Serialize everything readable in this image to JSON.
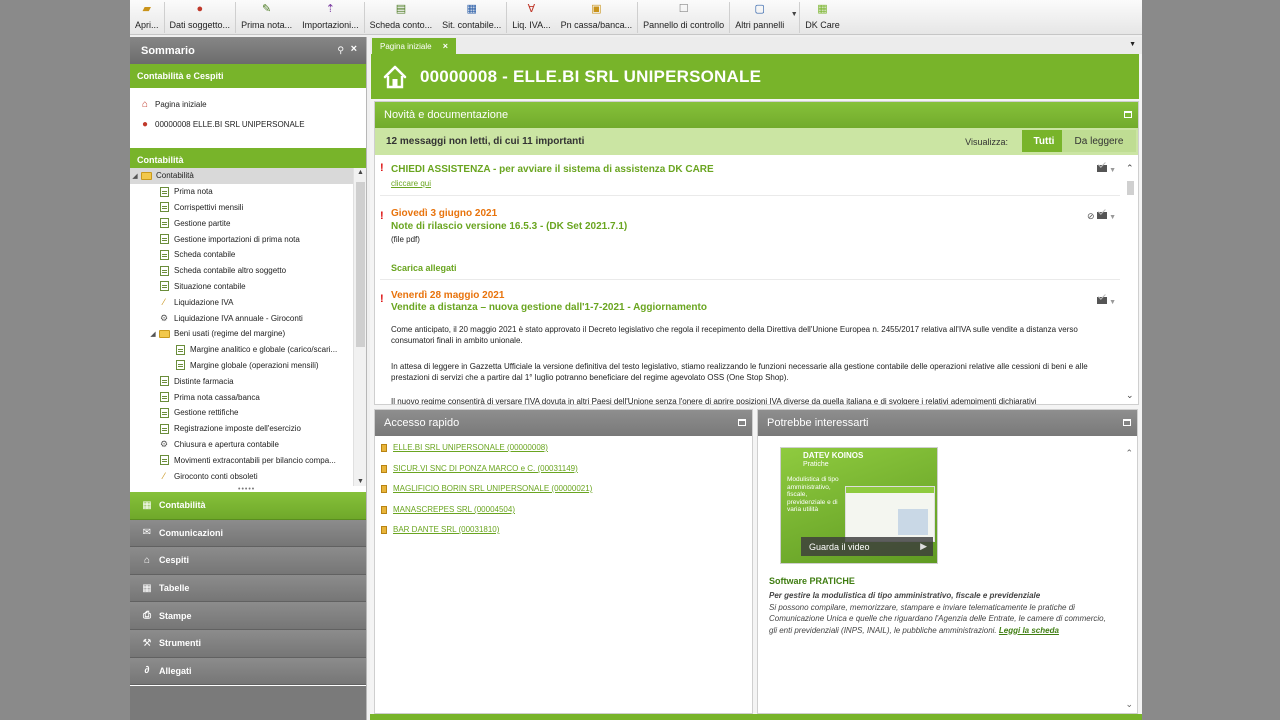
{
  "toolbar": {
    "items": [
      {
        "label": "Apri...",
        "icon": "folder-open-icon"
      },
      {
        "label": "Dati soggetto...",
        "icon": "person-icon"
      },
      {
        "label": "Prima nota...",
        "icon": "journal-icon"
      },
      {
        "label": "Importazioni...",
        "icon": "import-icon"
      },
      {
        "label": "Scheda conto...",
        "icon": "account-sheet-icon"
      },
      {
        "label": "Sit. contabile...",
        "icon": "ledger-icon"
      },
      {
        "label": "Liq. IVA...",
        "icon": "vat-icon"
      },
      {
        "label": "Pn cassa/banca...",
        "icon": "cash-icon"
      },
      {
        "label": "Pannello di controllo",
        "icon": "control-panel-icon"
      },
      {
        "label": "Altri pannelli",
        "icon": "panels-icon"
      },
      {
        "label": "DK Care",
        "icon": "dk-care-icon"
      }
    ]
  },
  "sidebar": {
    "title": "Sommario",
    "section1": "Contabilità e Cespiti",
    "shortcuts": [
      {
        "label": "Pagina iniziale",
        "icon": "home-icon"
      },
      {
        "label": "00000008 ELLE.BI SRL UNIPERSONALE",
        "icon": "person-icon"
      }
    ],
    "section2": "Contabilità",
    "tree": [
      {
        "label": "Contabilità",
        "level": 0,
        "kind": "folder",
        "expanded": true,
        "selected": true
      },
      {
        "label": "Prima nota",
        "level": 1,
        "kind": "doc"
      },
      {
        "label": "Corrispettivi mensili",
        "level": 1,
        "kind": "doc"
      },
      {
        "label": "Gestione partite",
        "level": 1,
        "kind": "doc"
      },
      {
        "label": "Gestione importazioni di prima nota",
        "level": 1,
        "kind": "doc"
      },
      {
        "label": "Scheda contabile",
        "level": 1,
        "kind": "doc"
      },
      {
        "label": "Scheda contabile altro soggetto",
        "level": 1,
        "kind": "doc"
      },
      {
        "label": "Situazione contabile",
        "level": 1,
        "kind": "doc"
      },
      {
        "label": "Liquidazione IVA",
        "level": 1,
        "kind": "wand"
      },
      {
        "label": "Liquidazione IVA annuale - Giroconti",
        "level": 1,
        "kind": "gear"
      },
      {
        "label": "Beni usati (regime del margine)",
        "level": 1,
        "kind": "folder",
        "expanded": true
      },
      {
        "label": "Margine analitico e globale (carico/scari...",
        "level": 2,
        "kind": "doc"
      },
      {
        "label": "Margine globale (operazioni mensili)",
        "level": 2,
        "kind": "doc"
      },
      {
        "label": "Distinte farmacia",
        "level": 1,
        "kind": "doc"
      },
      {
        "label": "Prima nota cassa/banca",
        "level": 1,
        "kind": "doc"
      },
      {
        "label": "Gestione rettifiche",
        "level": 1,
        "kind": "doc"
      },
      {
        "label": "Registrazione imposte dell'esercizio",
        "level": 1,
        "kind": "doc"
      },
      {
        "label": "Chiusura e apertura contabile",
        "level": 1,
        "kind": "gear"
      },
      {
        "label": "Movimenti extracontabili per bilancio compa...",
        "level": 1,
        "kind": "doc"
      },
      {
        "label": "Giroconto conti obsoleti",
        "level": 1,
        "kind": "wand"
      }
    ],
    "nav": [
      {
        "label": "Contabilità",
        "icon": "table-icon",
        "active": true
      },
      {
        "label": "Comunicazioni",
        "icon": "envelope-icon",
        "active": false
      },
      {
        "label": "Cespiti",
        "icon": "factory-icon",
        "active": false
      },
      {
        "label": "Tabelle",
        "icon": "table-icon",
        "active": false
      },
      {
        "label": "Stampe",
        "icon": "printer-icon",
        "active": false
      },
      {
        "label": "Strumenti",
        "icon": "tools-icon",
        "active": false
      },
      {
        "label": "Allegati",
        "icon": "paperclip-icon",
        "active": false
      }
    ]
  },
  "main": {
    "tab": "Pagina iniziale",
    "header_title": "00000008 - ELLE.BI SRL UNIPERSONALE",
    "news": {
      "title": "Novità e documentazione",
      "summary": "12 messaggi non letti, di cui 11 importanti",
      "view_label": "Visualizza:",
      "btn_all": "Tutti",
      "btn_unread": "Da leggere",
      "item1_title": "CHIEDI ASSISTENZA - per avviare il sistema di assistenza DK CARE",
      "item1_link": "cliccare qui",
      "item2_date": "Giovedì 3 giugno 2021",
      "item2_title": "Note di rilascio versione 16.5.3 - (DK Set 2021.7.1)",
      "item2_note": "(file pdf)",
      "item2_link": "Scarica allegati",
      "item3_date": "Venerdì 28 maggio 2021",
      "item3_title": "Vendite a distanza – nuova gestione dall'1-7-2021 - Aggiornamento",
      "item3_p1": "Come anticipato, il 20 maggio 2021 è stato approvato il Decreto legislativo che regola il recepimento della Direttiva dell'Unione Europea n. 2455/2017 relativa all'IVA sulle vendite a distanza verso consumatori finali in ambito unionale.",
      "item3_p2": "In attesa di leggere in Gazzetta Ufficiale la versione definitiva del testo legislativo, stiamo realizzando le funzioni necessarie alla gestione contabile delle operazioni relative alle cessioni di beni e alle prestazioni di servizi che a partire dal 1° luglio potranno beneficiare del regime agevolato OSS (One Stop Shop).",
      "item3_p3": "Il nuovo regime consentirà di versare l'IVA dovuta in altri Paesi dell'Unione senza l'onere di aprire posizioni IVA diverse da quella italiana e di svolgere i relativi adempimenti dichiarativi"
    },
    "quick": {
      "title": "Accesso rapido",
      "items": [
        "ELLE.BI SRL UNIPERSONALE (00000008)",
        "SICUR.VI SNC DI PONZA MARCO e C. (00031149)",
        "MAGLIFICIO BORIN SRL UNIPERSONALE (00000021)",
        "MANASCREPES SRL (00004504)",
        "BAR DANTE SRL (00031810)"
      ]
    },
    "promo": {
      "title": "Potrebbe interessarti",
      "brand": "DATEV KOINOS",
      "brand_sub": "Pratiche",
      "blurb": "Modulistica di tipo amministrativo, fiscale, previdenziale e di varia utilità",
      "video_label": "Guarda il video",
      "heading": "Software PRATICHE",
      "subheading": "Per gestire la modulistica di tipo amministrativo, fiscale e previdenziale",
      "text": "Si possono compilare, memorizzare, stampare e inviare telematicamente le pratiche di Comunicazione Unica e quelle che riguardano l'Agenzia delle Entrate, le camere di commercio, gli enti previdenziali (INPS, INAIL), le pubbliche amministrazioni.",
      "link": "Leggi la scheda"
    }
  },
  "colors": {
    "accent_green": "#78b42a",
    "light_green": "#cbe5a3",
    "header_gray": "#7a7a7a",
    "news_date_orange": "#e8730c",
    "important_red": "#d11111"
  }
}
